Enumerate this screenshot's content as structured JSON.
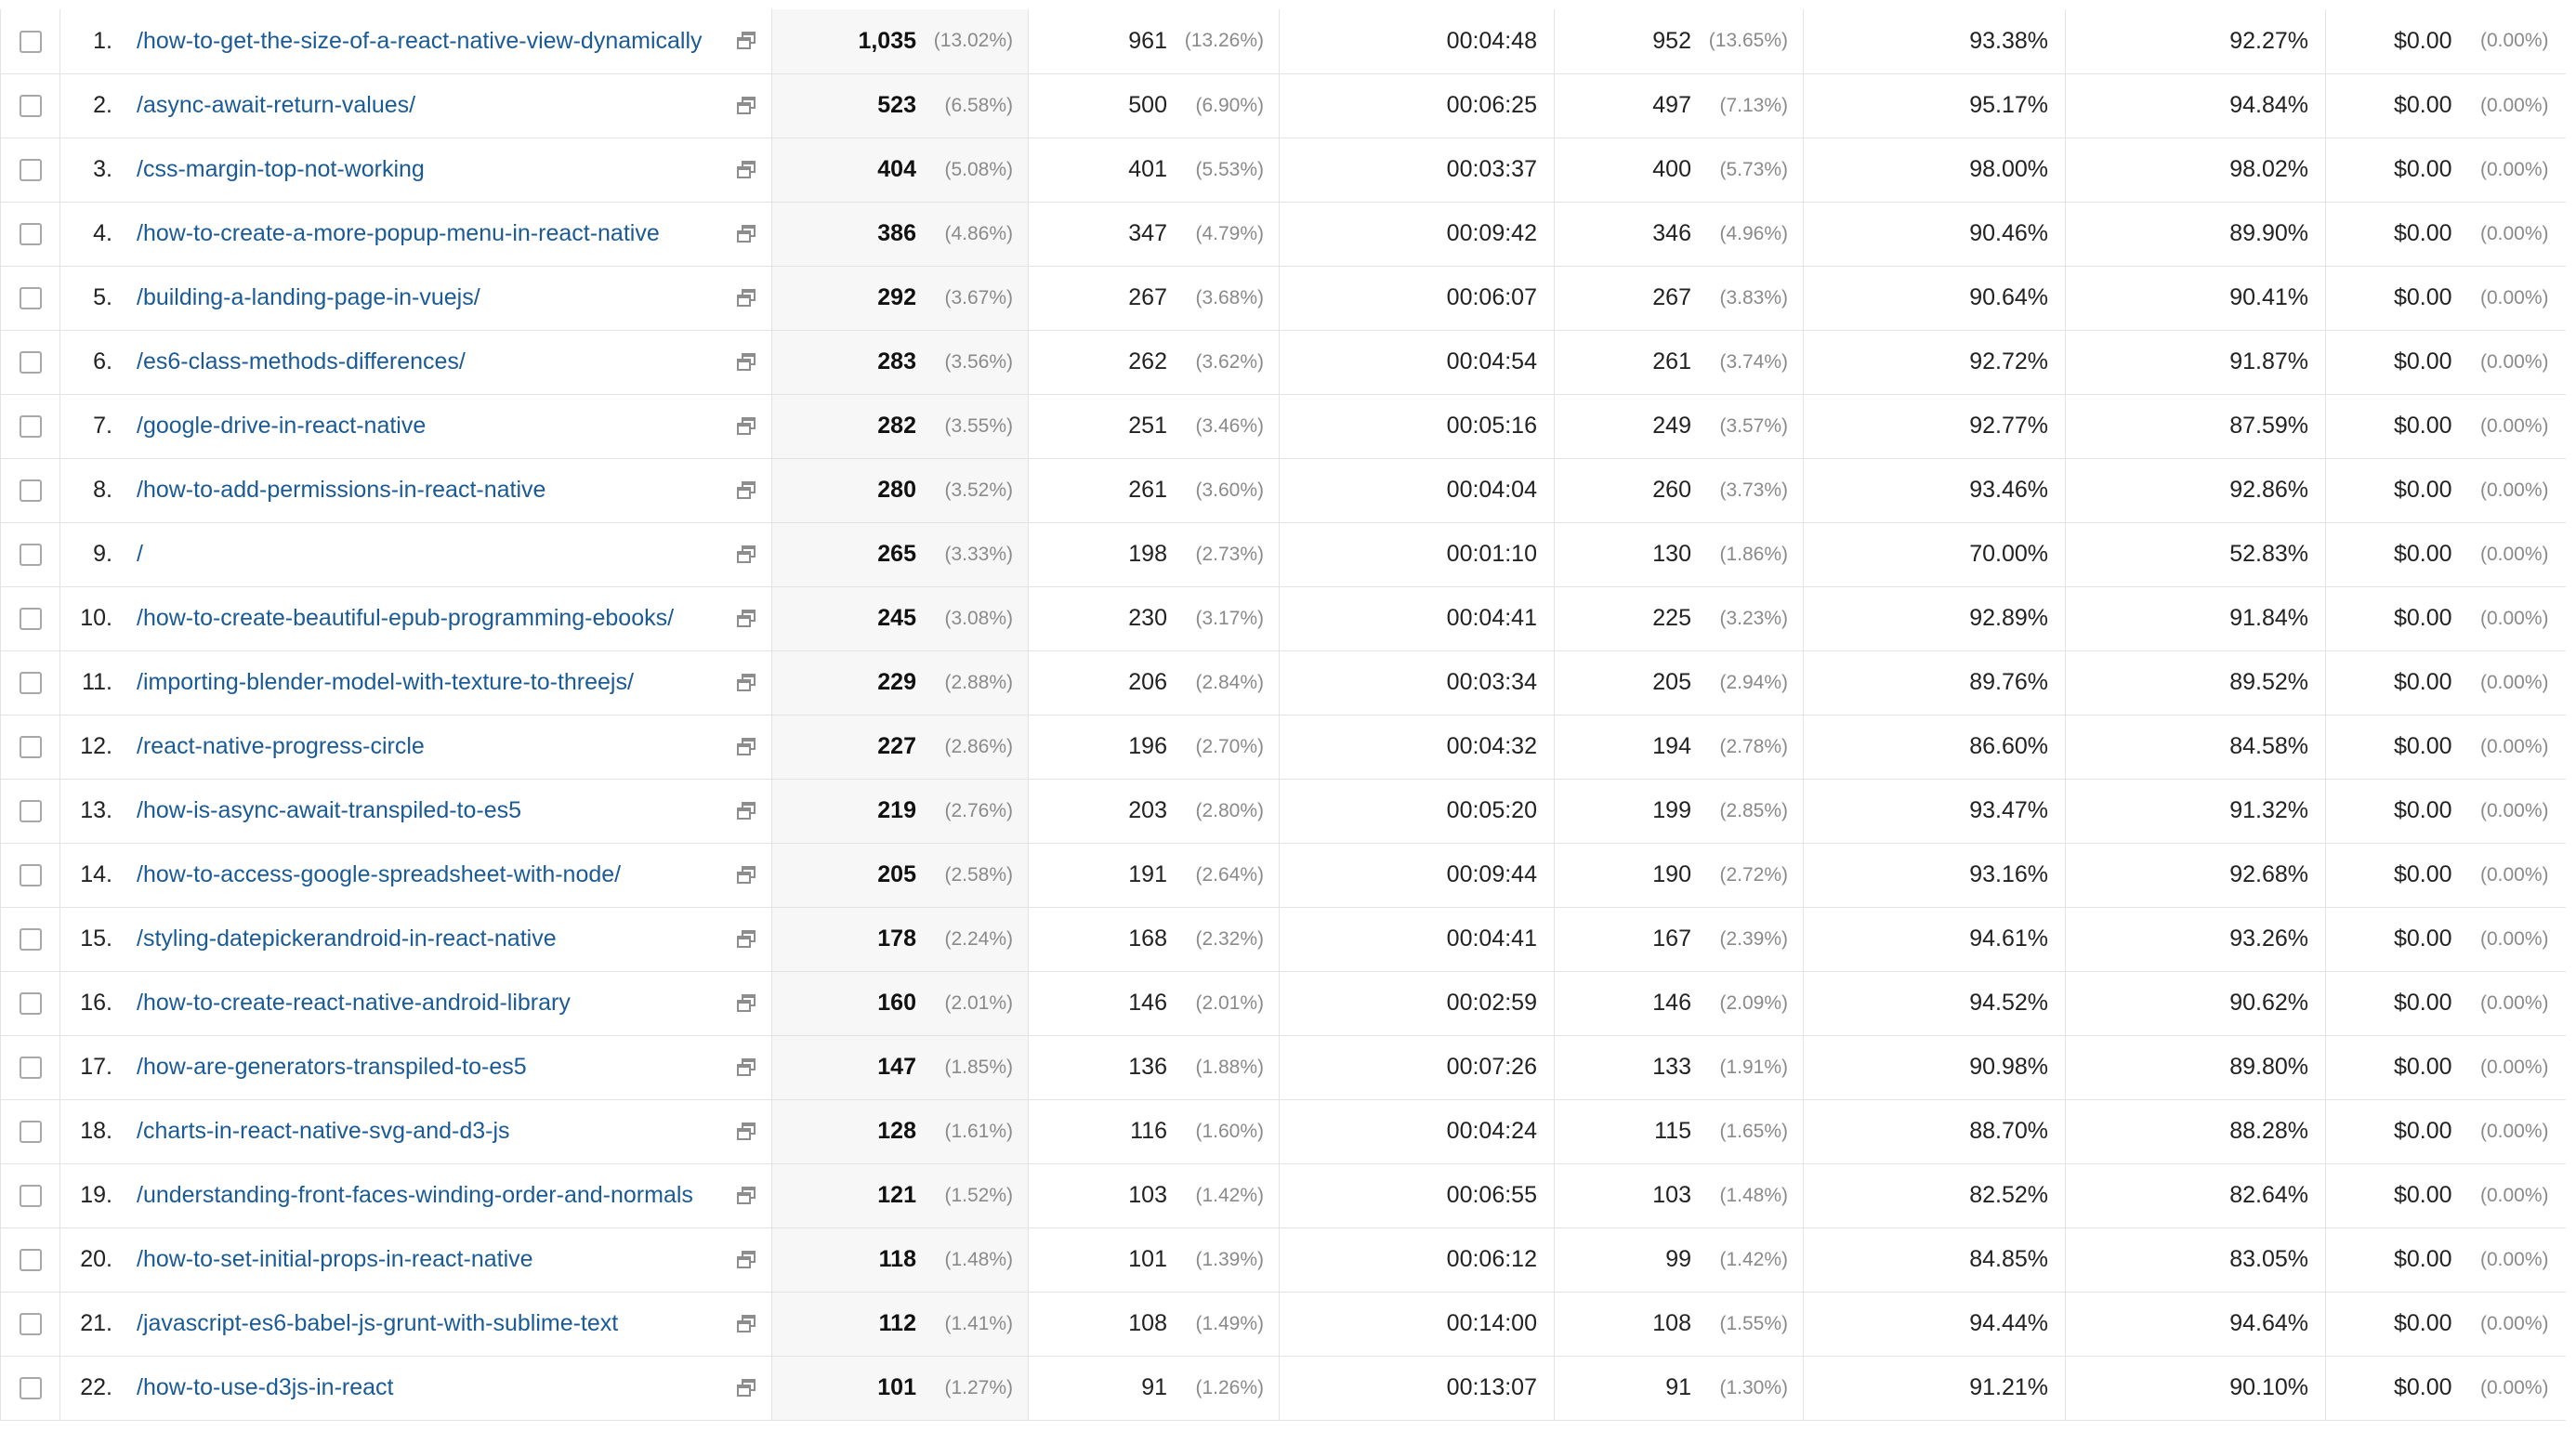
{
  "rows": [
    {
      "index": "1.",
      "page": "/how-to-get-the-size-of-a-react-native-view-dynamically",
      "pageviews": "1,035",
      "pageviews_pct": "(13.02%)",
      "unique": "961",
      "unique_pct": "(13.26%)",
      "avg_time": "00:04:48",
      "entrances": "952",
      "entrances_pct": "(13.65%)",
      "bounce": "93.38%",
      "exit": "92.27%",
      "value": "$0.00",
      "value_pct": "(0.00%)"
    },
    {
      "index": "2.",
      "page": "/async-await-return-values/",
      "pageviews": "523",
      "pageviews_pct": "(6.58%)",
      "unique": "500",
      "unique_pct": "(6.90%)",
      "avg_time": "00:06:25",
      "entrances": "497",
      "entrances_pct": "(7.13%)",
      "bounce": "95.17%",
      "exit": "94.84%",
      "value": "$0.00",
      "value_pct": "(0.00%)"
    },
    {
      "index": "3.",
      "page": "/css-margin-top-not-working",
      "pageviews": "404",
      "pageviews_pct": "(5.08%)",
      "unique": "401",
      "unique_pct": "(5.53%)",
      "avg_time": "00:03:37",
      "entrances": "400",
      "entrances_pct": "(5.73%)",
      "bounce": "98.00%",
      "exit": "98.02%",
      "value": "$0.00",
      "value_pct": "(0.00%)"
    },
    {
      "index": "4.",
      "page": "/how-to-create-a-more-popup-menu-in-react-native",
      "pageviews": "386",
      "pageviews_pct": "(4.86%)",
      "unique": "347",
      "unique_pct": "(4.79%)",
      "avg_time": "00:09:42",
      "entrances": "346",
      "entrances_pct": "(4.96%)",
      "bounce": "90.46%",
      "exit": "89.90%",
      "value": "$0.00",
      "value_pct": "(0.00%)"
    },
    {
      "index": "5.",
      "page": "/building-a-landing-page-in-vuejs/",
      "pageviews": "292",
      "pageviews_pct": "(3.67%)",
      "unique": "267",
      "unique_pct": "(3.68%)",
      "avg_time": "00:06:07",
      "entrances": "267",
      "entrances_pct": "(3.83%)",
      "bounce": "90.64%",
      "exit": "90.41%",
      "value": "$0.00",
      "value_pct": "(0.00%)"
    },
    {
      "index": "6.",
      "page": "/es6-class-methods-differences/",
      "pageviews": "283",
      "pageviews_pct": "(3.56%)",
      "unique": "262",
      "unique_pct": "(3.62%)",
      "avg_time": "00:04:54",
      "entrances": "261",
      "entrances_pct": "(3.74%)",
      "bounce": "92.72%",
      "exit": "91.87%",
      "value": "$0.00",
      "value_pct": "(0.00%)"
    },
    {
      "index": "7.",
      "page": "/google-drive-in-react-native",
      "pageviews": "282",
      "pageviews_pct": "(3.55%)",
      "unique": "251",
      "unique_pct": "(3.46%)",
      "avg_time": "00:05:16",
      "entrances": "249",
      "entrances_pct": "(3.57%)",
      "bounce": "92.77%",
      "exit": "87.59%",
      "value": "$0.00",
      "value_pct": "(0.00%)"
    },
    {
      "index": "8.",
      "page": "/how-to-add-permissions-in-react-native",
      "pageviews": "280",
      "pageviews_pct": "(3.52%)",
      "unique": "261",
      "unique_pct": "(3.60%)",
      "avg_time": "00:04:04",
      "entrances": "260",
      "entrances_pct": "(3.73%)",
      "bounce": "93.46%",
      "exit": "92.86%",
      "value": "$0.00",
      "value_pct": "(0.00%)"
    },
    {
      "index": "9.",
      "page": "/",
      "pageviews": "265",
      "pageviews_pct": "(3.33%)",
      "unique": "198",
      "unique_pct": "(2.73%)",
      "avg_time": "00:01:10",
      "entrances": "130",
      "entrances_pct": "(1.86%)",
      "bounce": "70.00%",
      "exit": "52.83%",
      "value": "$0.00",
      "value_pct": "(0.00%)"
    },
    {
      "index": "10.",
      "page": "/how-to-create-beautiful-epub-programming-ebooks/",
      "pageviews": "245",
      "pageviews_pct": "(3.08%)",
      "unique": "230",
      "unique_pct": "(3.17%)",
      "avg_time": "00:04:41",
      "entrances": "225",
      "entrances_pct": "(3.23%)",
      "bounce": "92.89%",
      "exit": "91.84%",
      "value": "$0.00",
      "value_pct": "(0.00%)"
    },
    {
      "index": "11.",
      "page": "/importing-blender-model-with-texture-to-threejs/",
      "pageviews": "229",
      "pageviews_pct": "(2.88%)",
      "unique": "206",
      "unique_pct": "(2.84%)",
      "avg_time": "00:03:34",
      "entrances": "205",
      "entrances_pct": "(2.94%)",
      "bounce": "89.76%",
      "exit": "89.52%",
      "value": "$0.00",
      "value_pct": "(0.00%)"
    },
    {
      "index": "12.",
      "page": "/react-native-progress-circle",
      "pageviews": "227",
      "pageviews_pct": "(2.86%)",
      "unique": "196",
      "unique_pct": "(2.70%)",
      "avg_time": "00:04:32",
      "entrances": "194",
      "entrances_pct": "(2.78%)",
      "bounce": "86.60%",
      "exit": "84.58%",
      "value": "$0.00",
      "value_pct": "(0.00%)"
    },
    {
      "index": "13.",
      "page": "/how-is-async-await-transpiled-to-es5",
      "pageviews": "219",
      "pageviews_pct": "(2.76%)",
      "unique": "203",
      "unique_pct": "(2.80%)",
      "avg_time": "00:05:20",
      "entrances": "199",
      "entrances_pct": "(2.85%)",
      "bounce": "93.47%",
      "exit": "91.32%",
      "value": "$0.00",
      "value_pct": "(0.00%)"
    },
    {
      "index": "14.",
      "page": "/how-to-access-google-spreadsheet-with-node/",
      "pageviews": "205",
      "pageviews_pct": "(2.58%)",
      "unique": "191",
      "unique_pct": "(2.64%)",
      "avg_time": "00:09:44",
      "entrances": "190",
      "entrances_pct": "(2.72%)",
      "bounce": "93.16%",
      "exit": "92.68%",
      "value": "$0.00",
      "value_pct": "(0.00%)"
    },
    {
      "index": "15.",
      "page": "/styling-datepickerandroid-in-react-native",
      "pageviews": "178",
      "pageviews_pct": "(2.24%)",
      "unique": "168",
      "unique_pct": "(2.32%)",
      "avg_time": "00:04:41",
      "entrances": "167",
      "entrances_pct": "(2.39%)",
      "bounce": "94.61%",
      "exit": "93.26%",
      "value": "$0.00",
      "value_pct": "(0.00%)"
    },
    {
      "index": "16.",
      "page": "/how-to-create-react-native-android-library",
      "pageviews": "160",
      "pageviews_pct": "(2.01%)",
      "unique": "146",
      "unique_pct": "(2.01%)",
      "avg_time": "00:02:59",
      "entrances": "146",
      "entrances_pct": "(2.09%)",
      "bounce": "94.52%",
      "exit": "90.62%",
      "value": "$0.00",
      "value_pct": "(0.00%)"
    },
    {
      "index": "17.",
      "page": "/how-are-generators-transpiled-to-es5",
      "pageviews": "147",
      "pageviews_pct": "(1.85%)",
      "unique": "136",
      "unique_pct": "(1.88%)",
      "avg_time": "00:07:26",
      "entrances": "133",
      "entrances_pct": "(1.91%)",
      "bounce": "90.98%",
      "exit": "89.80%",
      "value": "$0.00",
      "value_pct": "(0.00%)"
    },
    {
      "index": "18.",
      "page": "/charts-in-react-native-svg-and-d3-js",
      "pageviews": "128",
      "pageviews_pct": "(1.61%)",
      "unique": "116",
      "unique_pct": "(1.60%)",
      "avg_time": "00:04:24",
      "entrances": "115",
      "entrances_pct": "(1.65%)",
      "bounce": "88.70%",
      "exit": "88.28%",
      "value": "$0.00",
      "value_pct": "(0.00%)"
    },
    {
      "index": "19.",
      "page": "/understanding-front-faces-winding-order-and-normals",
      "pageviews": "121",
      "pageviews_pct": "(1.52%)",
      "unique": "103",
      "unique_pct": "(1.42%)",
      "avg_time": "00:06:55",
      "entrances": "103",
      "entrances_pct": "(1.48%)",
      "bounce": "82.52%",
      "exit": "82.64%",
      "value": "$0.00",
      "value_pct": "(0.00%)"
    },
    {
      "index": "20.",
      "page": "/how-to-set-initial-props-in-react-native",
      "pageviews": "118",
      "pageviews_pct": "(1.48%)",
      "unique": "101",
      "unique_pct": "(1.39%)",
      "avg_time": "00:06:12",
      "entrances": "99",
      "entrances_pct": "(1.42%)",
      "bounce": "84.85%",
      "exit": "83.05%",
      "value": "$0.00",
      "value_pct": "(0.00%)"
    },
    {
      "index": "21.",
      "page": "/javascript-es6-babel-js-grunt-with-sublime-text",
      "pageviews": "112",
      "pageviews_pct": "(1.41%)",
      "unique": "108",
      "unique_pct": "(1.49%)",
      "avg_time": "00:14:00",
      "entrances": "108",
      "entrances_pct": "(1.55%)",
      "bounce": "94.44%",
      "exit": "94.64%",
      "value": "$0.00",
      "value_pct": "(0.00%)"
    },
    {
      "index": "22.",
      "page": "/how-to-use-d3js-in-react",
      "pageviews": "101",
      "pageviews_pct": "(1.27%)",
      "unique": "91",
      "unique_pct": "(1.26%)",
      "avg_time": "00:13:07",
      "entrances": "91",
      "entrances_pct": "(1.30%)",
      "bounce": "91.21%",
      "exit": "90.10%",
      "value": "$0.00",
      "value_pct": "(0.00%)"
    }
  ],
  "colors": {
    "link": "#1a5a96",
    "grid": "#e3e3e3",
    "highlight_column": "#f7f7f7",
    "muted": "#8a8a8a"
  },
  "icons": {
    "row_action": "open-in-new-window-icon",
    "row_select": "checkbox-icon"
  }
}
